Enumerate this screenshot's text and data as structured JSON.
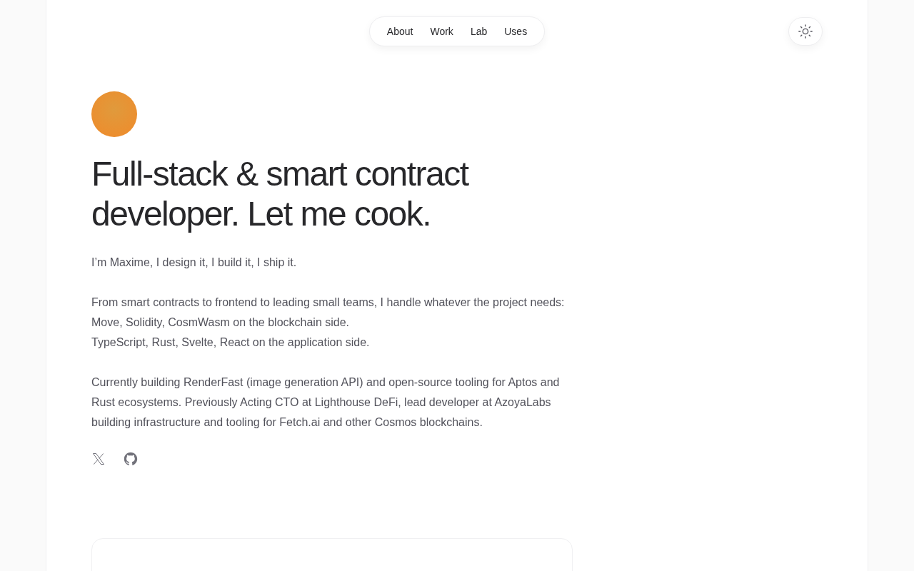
{
  "nav": {
    "items": [
      "About",
      "Work",
      "Lab",
      "Uses"
    ]
  },
  "hero": {
    "title": "Full-stack & smart contract developer. Let me cook.",
    "paragraphs": [
      [
        "I’m Maxime, I design it, I build it, I ship it."
      ],
      [
        "From smart contracts to frontend to leading small teams, I handle whatever the project needs:",
        "Move, Solidity, CosmWasm on the blockchain side.",
        "TypeScript, Rust, Svelte, React on the application side."
      ],
      [
        "Currently building RenderFast (image generation API) and open-source tooling for Aptos and Rust ecosystems. Previously Acting CTO at Lighthouse DeFi, lead developer at AzoyaLabs building infrastructure and tooling for Fetch.ai and other Cosmos blockchains."
      ]
    ]
  }
}
